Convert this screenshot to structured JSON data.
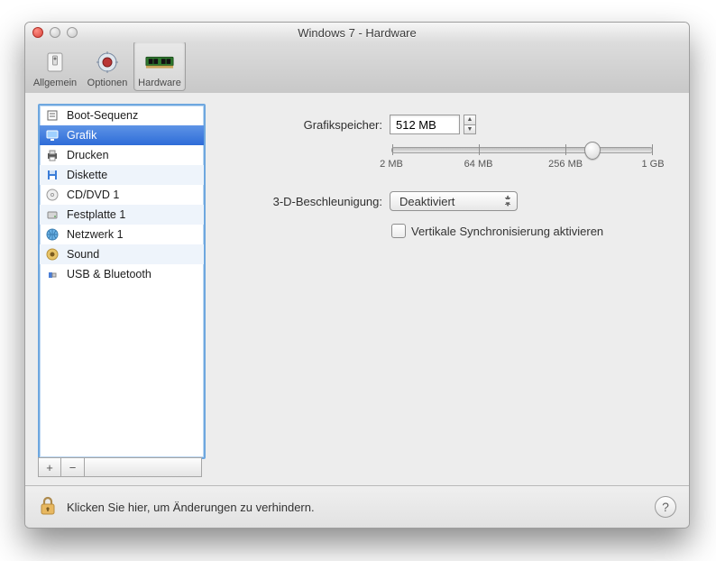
{
  "window": {
    "title": "Windows 7 - Hardware"
  },
  "toolbar": {
    "items": [
      {
        "label": "Allgemein",
        "icon": "switch-icon"
      },
      {
        "label": "Optionen",
        "icon": "chip-icon"
      },
      {
        "label": "Hardware",
        "icon": "ram-icon"
      }
    ],
    "selected": 2
  },
  "sidebar": {
    "items": [
      {
        "label": "Boot-Sequenz",
        "icon": "boot-icon"
      },
      {
        "label": "Grafik",
        "icon": "display-icon"
      },
      {
        "label": "Drucken",
        "icon": "printer-icon"
      },
      {
        "label": "Diskette",
        "icon": "floppy-icon"
      },
      {
        "label": "CD/DVD 1",
        "icon": "cd-icon"
      },
      {
        "label": "Festplatte 1",
        "icon": "hdd-icon"
      },
      {
        "label": "Netzwerk 1",
        "icon": "network-icon"
      },
      {
        "label": "Sound",
        "icon": "sound-icon"
      },
      {
        "label": "USB & Bluetooth",
        "icon": "usb-icon"
      }
    ],
    "selected": 1,
    "add_label": "+",
    "remove_label": "−"
  },
  "form": {
    "memory_label": "Grafikspeicher:",
    "memory_value": "512 MB",
    "slider": {
      "ticks": [
        "2 MB",
        "64 MB",
        "256 MB",
        "1 GB"
      ],
      "value_pct": 77
    },
    "accel_label": "3-D-Beschleunigung:",
    "accel_value": "Deaktiviert",
    "vsync_label": "Vertikale Synchronisierung aktivieren",
    "vsync_checked": false
  },
  "bottom": {
    "lock_text": "Klicken Sie hier, um Änderungen zu verhindern.",
    "help_label": "?"
  }
}
